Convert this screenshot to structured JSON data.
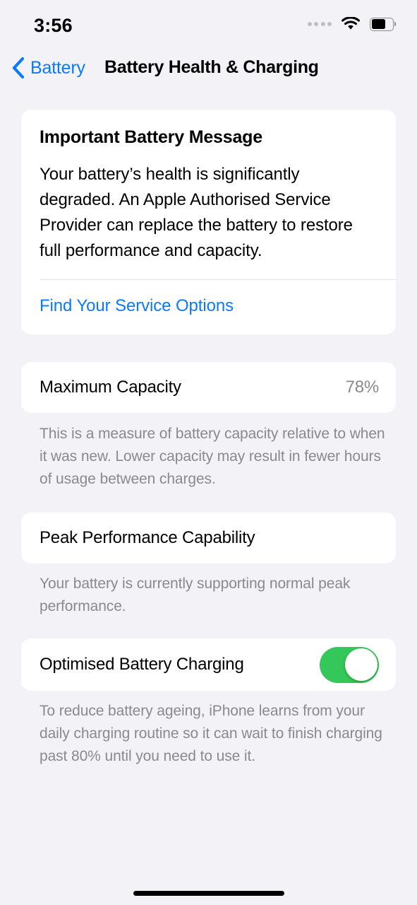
{
  "status_bar": {
    "time": "3:56",
    "cellular_icon": "signal-dots-icon",
    "wifi_icon": "wifi-icon",
    "battery_icon": "battery-icon",
    "battery_fill_percent": 65
  },
  "nav": {
    "back_label": "Battery",
    "back_icon": "chevron-left-icon",
    "title": "Battery Health & Charging",
    "accent_color": "#0A7AFF"
  },
  "message_card": {
    "heading": "Important Battery Message",
    "body": "Your battery’s health is significantly degraded. An Apple Authorised Service Provider can replace the battery to restore full performance and capacity.",
    "link_label": "Find Your Service Options"
  },
  "capacity_row": {
    "label": "Maximum Capacity",
    "value": "78%"
  },
  "capacity_footer": "This is a measure of battery capacity relative to when it was new. Lower capacity may result in fewer hours of usage between charges.",
  "peak_row": {
    "label": "Peak Performance Capability"
  },
  "peak_footer": "Your battery is currently supporting normal peak performance.",
  "optimised_row": {
    "label": "Optimised Battery Charging",
    "toggle_state": "on",
    "toggle_on_color": "#34C759"
  },
  "optimised_footer": "To reduce battery ageing, iPhone learns from your daily charging routine so it can wait to finish charging past 80% until you need to use it.",
  "home_indicator": "home-indicator"
}
